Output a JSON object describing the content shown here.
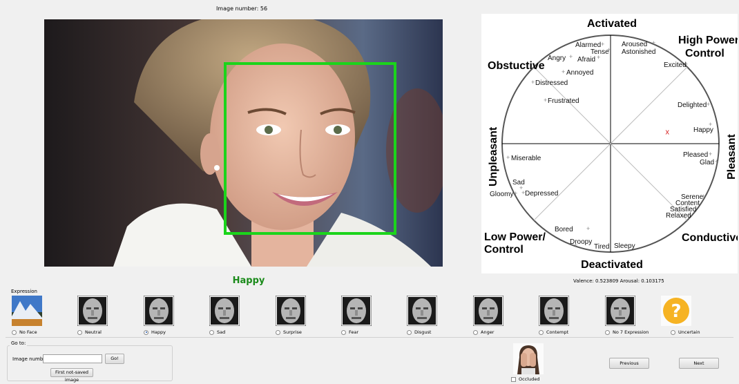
{
  "header": {
    "image_number_text": "Image number: 56"
  },
  "prediction": {
    "label": "Happy",
    "valence_arousal_text": "Valence: 0.523809    Arousal: 0.103175"
  },
  "circumplex": {
    "quadrant_labels": {
      "top": "Activated",
      "bottom": "Deactivated",
      "left": "Unpleasant",
      "right": "Pleasant",
      "top_left": "Obstuctive",
      "top_right": [
        "High Power/",
        "Control"
      ],
      "bottom_left": [
        "Low Power/",
        "Control"
      ],
      "bottom_right": "Conductive"
    },
    "emotions": [
      "Alarmed",
      "Tense",
      "Afraid",
      "Angry",
      "Annoyed",
      "Distressed",
      "Frustrated",
      "Aroused",
      "Astonished",
      "Excited",
      "Delighted",
      "Happy",
      "Pleased",
      "Glad",
      "Serene",
      "Content",
      "Satisfied",
      "Relaxed",
      "Sleepy",
      "Tired",
      "Droopy",
      "Bored",
      "Miserable",
      "Sad",
      "Gloomy",
      "Depressed"
    ],
    "marker": "x",
    "marker_color": "#d62020",
    "point": {
      "valence": 0.523809,
      "arousal": 0.103175
    }
  },
  "expression": {
    "title": "Expression",
    "selected": "Happy",
    "options": [
      {
        "label": "No Face",
        "icon": "landscape-icon"
      },
      {
        "label": "Neutral",
        "icon": "face-photo-icon"
      },
      {
        "label": "Happy",
        "icon": "face-photo-icon"
      },
      {
        "label": "Sad",
        "icon": "face-photo-icon"
      },
      {
        "label": "Surprise",
        "icon": "face-photo-icon"
      },
      {
        "label": "Fear",
        "icon": "face-photo-icon"
      },
      {
        "label": "Disgust",
        "icon": "face-photo-icon"
      },
      {
        "label": "Anger",
        "icon": "face-photo-icon"
      },
      {
        "label": "Contempt",
        "icon": "face-photo-icon"
      },
      {
        "label": "No 7 Expression",
        "icon": "face-photo-icon"
      },
      {
        "label": "Uncertain",
        "icon": "question-icon"
      }
    ]
  },
  "goto": {
    "title": "Go to:",
    "image_number_label": "Image number:",
    "image_number_value": "",
    "go_label": "Go!",
    "first_unsaved_label": "First not-saved image"
  },
  "nav": {
    "previous_label": "Previous",
    "next_label": "Next"
  },
  "occluded": {
    "label": "Occluded",
    "checked": false
  },
  "colors": {
    "face_box": "#1bd41b",
    "prediction": "#1a8a1a",
    "marker": "#d62020"
  }
}
